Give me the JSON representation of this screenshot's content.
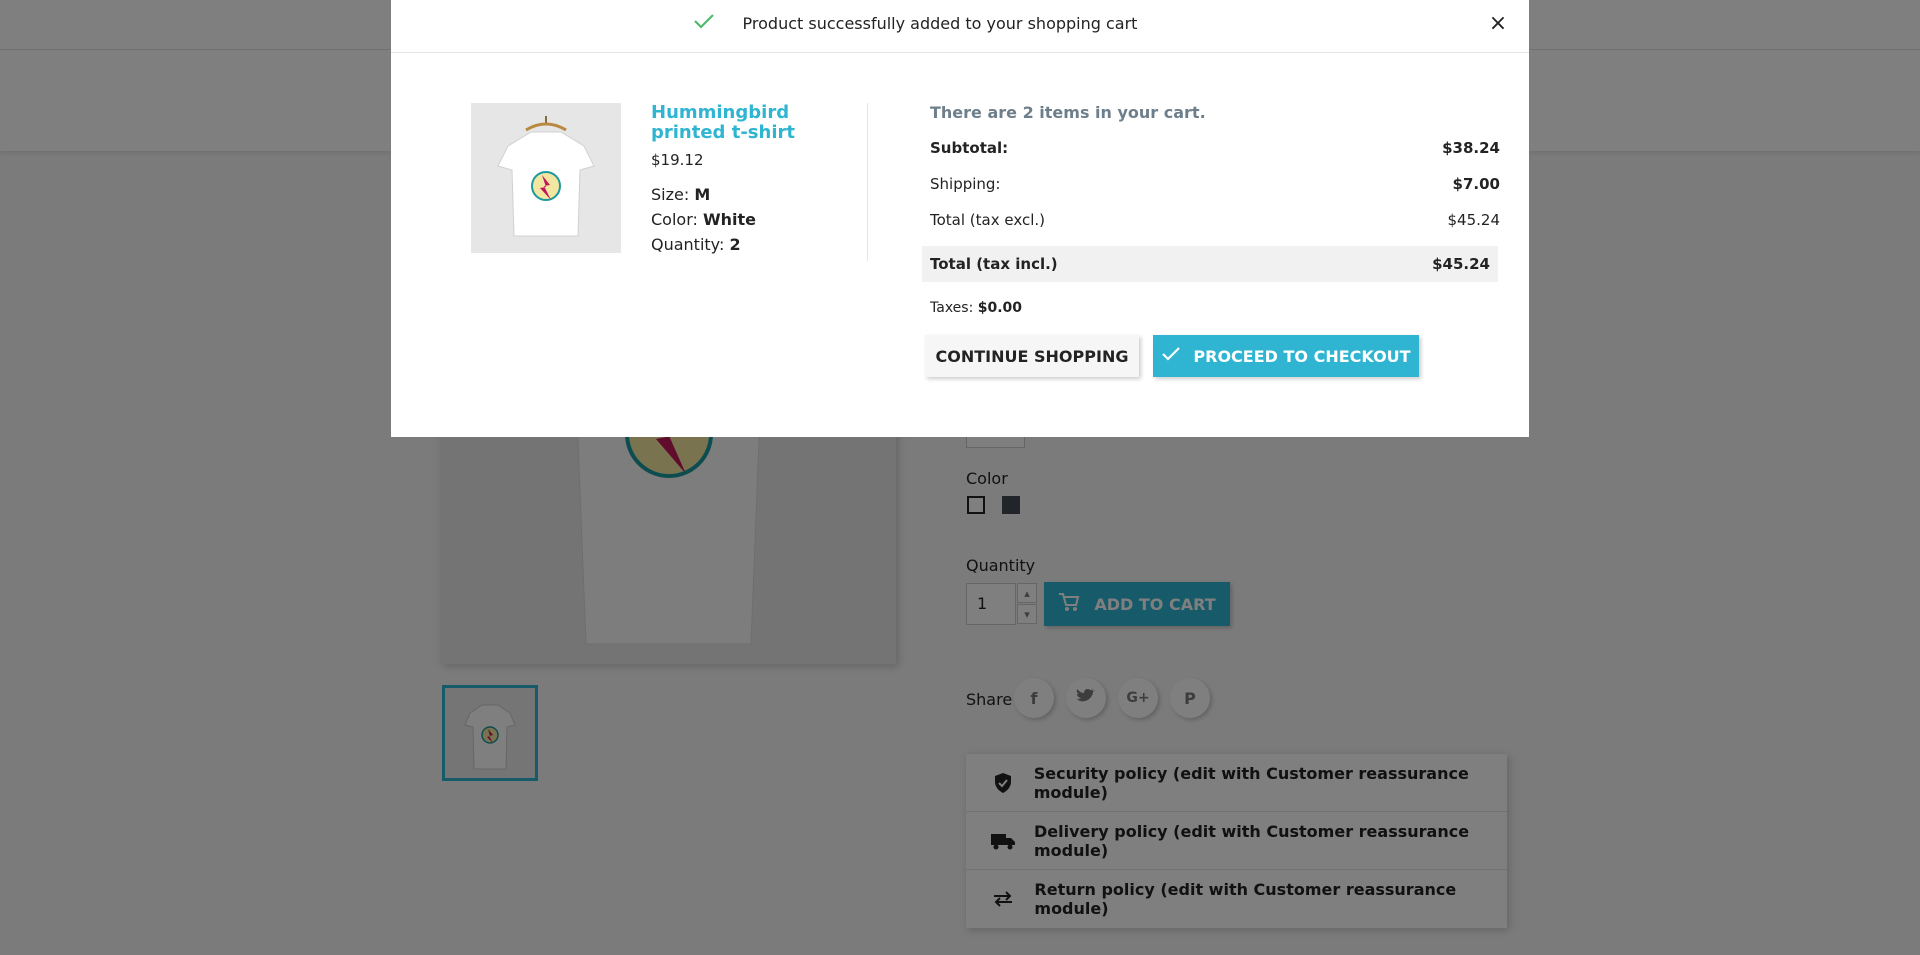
{
  "modal": {
    "title": "Product successfully added to your shopping cart",
    "close_symbol": "×",
    "product": {
      "name": "Hummingbird printed t-shirt",
      "price": "$19.12",
      "size_label": "Size:",
      "size_value": "M",
      "color_label": "Color:",
      "color_value": "White",
      "quantity_label": "Quantity:",
      "quantity_value": "2"
    },
    "cart": {
      "count_text": "There are 2 items in your cart.",
      "subtotal_label": "Subtotal:",
      "subtotal_value": "$38.24",
      "shipping_label": "Shipping:",
      "shipping_value": "$7.00",
      "total_excl_label": "Total (tax excl.)",
      "total_excl_value": "$45.24",
      "total_incl_label": "Total (tax incl.)",
      "total_incl_value": "$45.24",
      "taxes_label": "Taxes:",
      "taxes_value": "$0.00"
    },
    "buttons": {
      "continue": "CONTINUE SHOPPING",
      "checkout": "PROCEED TO CHECKOUT"
    }
  },
  "page": {
    "color_label": "Color",
    "quantity_label": "Quantity",
    "quantity_value": "1",
    "add_to_cart": "ADD TO CART",
    "share_label": "Share",
    "share_icons": [
      "facebook-icon",
      "twitter-icon",
      "google-plus-icon",
      "pinterest-icon"
    ],
    "reassurance": [
      {
        "icon": "shield-icon",
        "text": "Security policy (edit with Customer reassurance module)"
      },
      {
        "icon": "truck-icon",
        "text": "Delivery policy (edit with Customer reassurance module)"
      },
      {
        "icon": "swap-arrows-icon",
        "text": "Return policy (edit with Customer reassurance module)"
      }
    ],
    "swatch_colors": [
      "#ffffff",
      "#434a54"
    ]
  },
  "colors": {
    "accent": "#2fb5d2",
    "success": "#4cbb6c",
    "overlay": "rgba(0,0,0,0.5)"
  }
}
